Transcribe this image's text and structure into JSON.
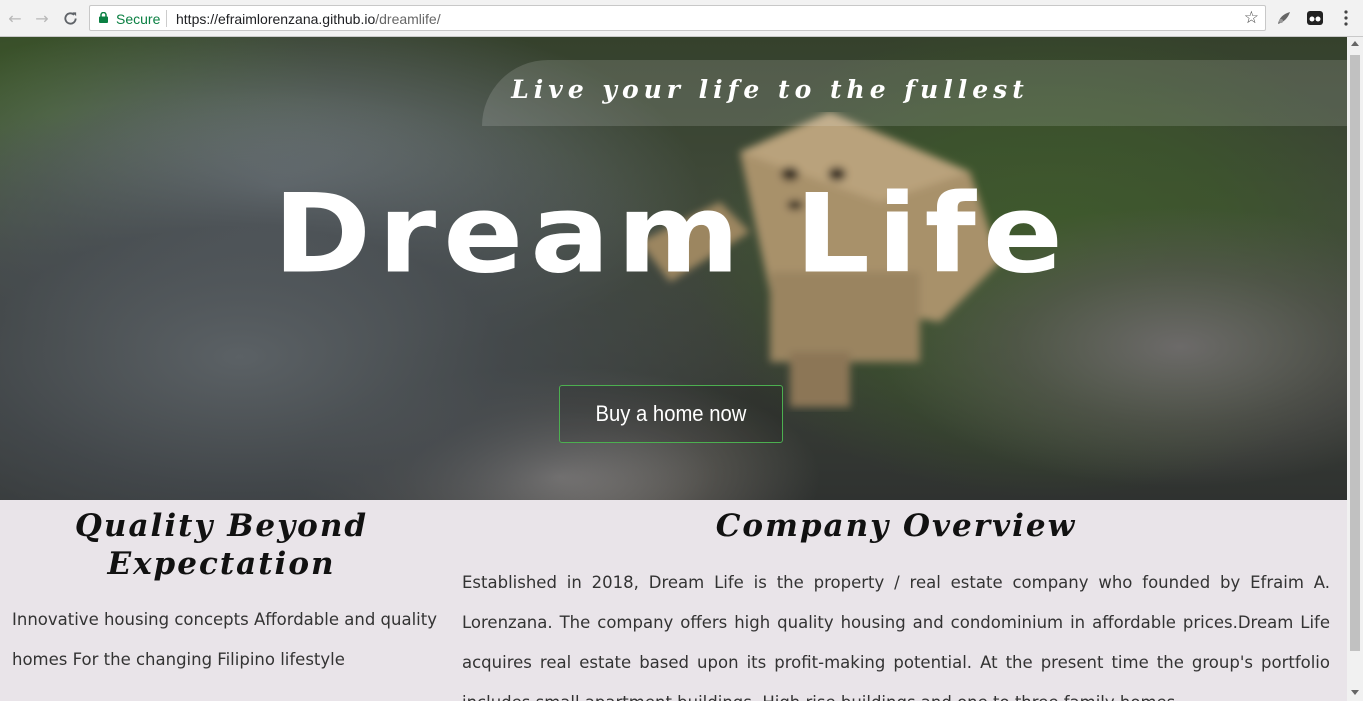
{
  "browser": {
    "secure_label": "Secure",
    "url_base": "https://efraimlorenzana.github.io",
    "url_path": "/dreamlife/"
  },
  "hero": {
    "tagline": "Live your life to the fullest",
    "title": "Dream Life",
    "cta_label": "Buy a home now"
  },
  "quality": {
    "heading": "Quality Beyond Expectation",
    "text": "Innovative housing concepts Affordable and quality homes For the changing Filipino lifestyle"
  },
  "overview": {
    "heading": "Company Overview",
    "text": "Established in 2018, Dream Life is the property / real estate company who founded by Efraim A. Lorenzana. The company offers high quality housing and condominium in affordable prices.Dream Life acquires real estate based upon its profit-making potential. At the present time the group's portfolio includes small apartment buildings, High rise buildings and one to three family homes."
  },
  "colors": {
    "accent_border": "#4caf50",
    "content_bg": "#e9e4e9",
    "secure_green": "#0b8043"
  }
}
